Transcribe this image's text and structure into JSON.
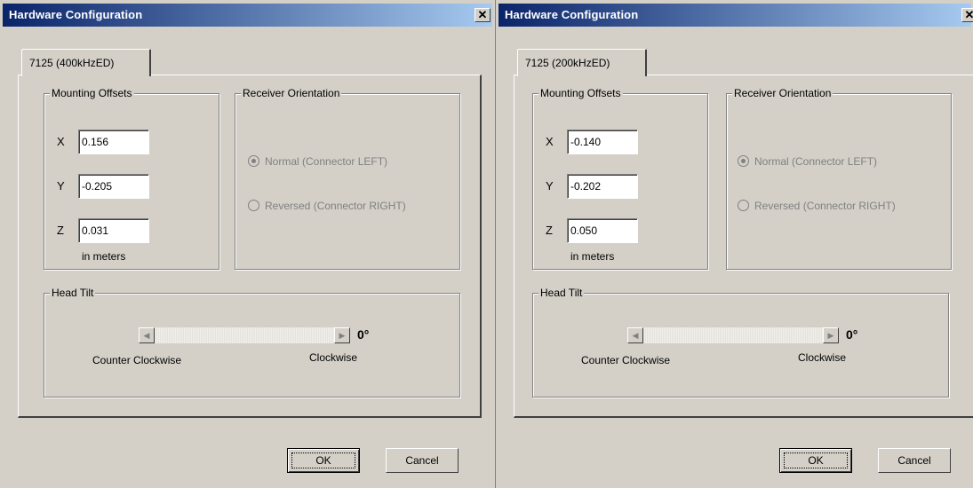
{
  "dialogs": [
    {
      "title": "Hardware Configuration",
      "close_glyph": "✕",
      "tab_label": "7125 (400kHzED)",
      "mounting_offsets": {
        "legend": "Mounting Offsets",
        "x_label": "X",
        "x_value": "0.156",
        "y_label": "Y",
        "y_value": "-0.205",
        "z_label": "Z",
        "z_value": "0.031",
        "units": "in meters"
      },
      "receiver_orientation": {
        "legend": "Receiver Orientation",
        "normal_label": "Normal  (Connector LEFT)",
        "reversed_label": "Reversed  (Connector RIGHT)"
      },
      "head_tilt": {
        "legend": "Head Tilt",
        "left_arrow": "◀",
        "right_arrow": "▶",
        "value": "0°",
        "ccw_label": "Counter Clockwise",
        "cw_label": "Clockwise"
      },
      "ok_label": "OK",
      "cancel_label": "Cancel"
    },
    {
      "title": "Hardware Configuration",
      "close_glyph": "✕",
      "tab_label": "7125 (200kHzED)",
      "mounting_offsets": {
        "legend": "Mounting Offsets",
        "x_label": "X",
        "x_value": "-0.140",
        "y_label": "Y",
        "y_value": "-0.202",
        "z_label": "Z",
        "z_value": "0.050",
        "units": "in meters"
      },
      "receiver_orientation": {
        "legend": "Receiver Orientation",
        "normal_label": "Normal  (Connector LEFT)",
        "reversed_label": "Reversed  (Connector RIGHT)"
      },
      "head_tilt": {
        "legend": "Head Tilt",
        "left_arrow": "◀",
        "right_arrow": "▶",
        "value": "0°",
        "ccw_label": "Counter Clockwise",
        "cw_label": "Clockwise"
      },
      "ok_label": "OK",
      "cancel_label": "Cancel"
    }
  ]
}
